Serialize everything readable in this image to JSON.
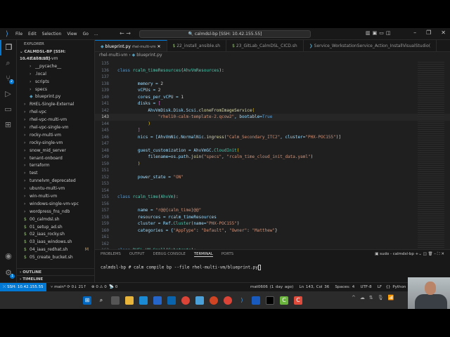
{
  "menu": [
    "File",
    "Edit",
    "Selection",
    "View",
    "Go",
    "..."
  ],
  "command_center": "calmdsl-bp [SSH: 10.42.155.55]",
  "sidebar": {
    "title": "EXPLORER",
    "root": "CALMDSL-BP [SSH: 10.42.155.55]",
    "items": [
      {
        "label": "rhel-multi-vm",
        "type": "folder-open",
        "depth": 1
      },
      {
        "label": "__pycache__",
        "type": "folder",
        "depth": 2
      },
      {
        "label": ".local",
        "type": "folder",
        "depth": 2
      },
      {
        "label": "scripts",
        "type": "folder",
        "depth": 2
      },
      {
        "label": "specs",
        "type": "folder",
        "depth": 2
      },
      {
        "label": "blueprint.py",
        "type": "py",
        "depth": 2
      },
      {
        "label": "RHEL-Single-External",
        "type": "folder",
        "depth": 1
      },
      {
        "label": "rhel-vpc",
        "type": "folder",
        "depth": 1
      },
      {
        "label": "rhel-vpc-multi-vm",
        "type": "folder",
        "depth": 1
      },
      {
        "label": "rhel-vpc-single-vm",
        "type": "folder",
        "depth": 1
      },
      {
        "label": "rocky-multi-vm",
        "type": "folder",
        "depth": 1
      },
      {
        "label": "rocky-single-vm",
        "type": "folder",
        "depth": 1
      },
      {
        "label": "snow_mid_server",
        "type": "folder",
        "depth": 1
      },
      {
        "label": "tenant-onboard",
        "type": "folder",
        "depth": 1
      },
      {
        "label": "terraform",
        "type": "folder",
        "depth": 1
      },
      {
        "label": "test",
        "type": "folder",
        "depth": 1
      },
      {
        "label": "tunnelvm_deprecated",
        "type": "folder",
        "depth": 1
      },
      {
        "label": "ubuntu-multi-vm",
        "type": "folder",
        "depth": 1
      },
      {
        "label": "win-multi-vm",
        "type": "folder",
        "depth": 1
      },
      {
        "label": "windows-single-vm-vpc",
        "type": "folder",
        "depth": 1
      },
      {
        "label": "wordpress_fns_ndb",
        "type": "folder",
        "depth": 1
      },
      {
        "label": "00_calmdsl.sh",
        "type": "sh",
        "depth": 1
      },
      {
        "label": "01_setup_ad.sh",
        "type": "sh",
        "depth": 1
      },
      {
        "label": "02_iaas_rocky.sh",
        "type": "sh",
        "depth": 1
      },
      {
        "label": "03_iaas_windows.sh",
        "type": "sh",
        "depth": 1
      },
      {
        "label": "04_iaas_redhat.sh",
        "type": "sh",
        "depth": 1,
        "badge": "M"
      },
      {
        "label": "05_create_bucket.sh",
        "type": "sh",
        "depth": 1
      }
    ],
    "outline": "OUTLINE",
    "timeline": "TIMELINE"
  },
  "activity": {
    "scm_badge": "2",
    "settings_badge": "1"
  },
  "tabs": [
    {
      "label": "blueprint.py",
      "sub": "rhel-multi-vm",
      "active": true,
      "icon": "python-icon"
    },
    {
      "label": "22_install_ansible.sh",
      "icon": "shell-icon"
    },
    {
      "label": "23_GitLab_CalmDSL_CICD.sh",
      "icon": "shell-icon"
    },
    {
      "label": "Service_WorkstationService_Action_InstallVisualStudio(",
      "icon": "powershell-icon"
    }
  ],
  "breadcrumb": [
    "rhel-multi-vm",
    "blueprint.py"
  ],
  "code": [
    {
      "n": "135",
      "t": []
    },
    {
      "n": "136",
      "t": [
        [
          "class ",
          "k"
        ],
        [
          "rcalm_timeResources",
          "c"
        ],
        [
          "(",
          "p"
        ],
        [
          "AhvVmResources",
          "c"
        ],
        [
          "):",
          "p"
        ]
      ]
    },
    {
      "n": "137",
      "t": []
    },
    {
      "n": "138",
      "t": [
        [
          "        memory = ",
          "v"
        ],
        [
          "2",
          "p"
        ]
      ]
    },
    {
      "n": "139",
      "t": [
        [
          "        vCPUs = ",
          "v"
        ],
        [
          "2",
          "p"
        ]
      ]
    },
    {
      "n": "140",
      "t": [
        [
          "        cores_per_vCPU = ",
          "v"
        ],
        [
          "1",
          "p"
        ]
      ]
    },
    {
      "n": "141",
      "t": [
        [
          "        disks = ",
          "v"
        ],
        [
          "[",
          "b"
        ]
      ]
    },
    {
      "n": "142",
      "t": [
        [
          "            AhvVmDisk.Disk.Scsi.",
          "v"
        ],
        [
          "cloneFromImageService",
          "f"
        ],
        [
          "(",
          "y"
        ]
      ]
    },
    {
      "n": "143",
      "t": [
        [
          "                ",
          "p"
        ],
        [
          "\"rhel10-calm-template-2.qcow2\"",
          "s"
        ],
        [
          ", bootable=",
          "v"
        ],
        [
          "True",
          "k"
        ]
      ]
    },
    {
      "n": "144",
      "t": [
        [
          "            )",
          "y"
        ]
      ]
    },
    {
      "n": "145",
      "t": [
        [
          "        ]",
          "b"
        ]
      ]
    },
    {
      "n": "146",
      "t": [
        [
          "        nics = [AhvVmNic.NormalNic.",
          "v"
        ],
        [
          "ingress",
          "f"
        ],
        [
          "(",
          "p"
        ],
        [
          "\"Calm_Secondary_ITC2\"",
          "s"
        ],
        [
          ", cluster=",
          "v"
        ],
        [
          "\"PHX-POC155\"",
          "s"
        ],
        [
          ")]",
          "p"
        ]
      ]
    },
    {
      "n": "147",
      "t": []
    },
    {
      "n": "148",
      "t": [
        [
          "        guest_customization = AhvVmGC.",
          "v"
        ],
        [
          "CloudInit",
          "c"
        ],
        [
          "(",
          "y"
        ]
      ]
    },
    {
      "n": "149",
      "t": [
        [
          "            filename=os.path.",
          "v"
        ],
        [
          "join",
          "f"
        ],
        [
          "(",
          "p"
        ],
        [
          "\"specs\"",
          "s"
        ],
        [
          ", ",
          "p"
        ],
        [
          "\"rcalm_time_cloud_init_data.yaml\"",
          "s"
        ],
        [
          ")",
          "p"
        ]
      ]
    },
    {
      "n": "150",
      "t": [
        [
          "        )",
          "y"
        ]
      ]
    },
    {
      "n": "151",
      "t": []
    },
    {
      "n": "152",
      "t": [
        [
          "        power_state = ",
          "v"
        ],
        [
          "\"ON\"",
          "s"
        ]
      ]
    },
    {
      "n": "153",
      "t": []
    },
    {
      "n": "154",
      "t": []
    },
    {
      "n": "155",
      "t": [
        [
          "class ",
          "k"
        ],
        [
          "rcalm_time",
          "c"
        ],
        [
          "(",
          "p"
        ],
        [
          "AhvVm",
          "c"
        ],
        [
          "):",
          "p"
        ]
      ]
    },
    {
      "n": "156",
      "t": []
    },
    {
      "n": "157",
      "t": [
        [
          "        name = ",
          "v"
        ],
        [
          "\"r@@{calm_time}@@\"",
          "s"
        ]
      ]
    },
    {
      "n": "158",
      "t": [
        [
          "        resources = rcalm_timeResources",
          "v"
        ]
      ]
    },
    {
      "n": "159",
      "t": [
        [
          "        cluster = Ref.",
          "v"
        ],
        [
          "Cluster",
          "c"
        ],
        [
          "(name=",
          "v"
        ],
        [
          "\"PHX-POC155\"",
          "s"
        ],
        [
          ")",
          "p"
        ]
      ]
    },
    {
      "n": "160",
      "t": [
        [
          "        categories = {",
          "v"
        ],
        [
          "\"AppType\"",
          "s"
        ],
        [
          ": ",
          "p"
        ],
        [
          "\"Default\"",
          "s"
        ],
        [
          ", ",
          "p"
        ],
        [
          "\"Owner\"",
          "s"
        ],
        [
          ": ",
          "p"
        ],
        [
          "\"Matthew\"",
          "s"
        ],
        [
          "}",
          "p"
        ]
      ]
    },
    {
      "n": "161",
      "t": []
    },
    {
      "n": "162",
      "t": []
    },
    {
      "n": "163",
      "t": [
        [
          "class ",
          "k"
        ],
        [
          "RHEL_VM_Small",
          "c"
        ],
        [
          "(",
          "p"
        ],
        [
          "Substrate",
          "c"
        ],
        [
          "):",
          "p"
        ]
      ]
    }
  ],
  "current_line": "143",
  "panel": {
    "tabs": [
      "PROBLEMS",
      "OUTPUT",
      "DEBUG CONSOLE",
      "TERMINAL",
      "PORTS"
    ],
    "active": "TERMINAL",
    "terminal_name": "sudo - calmdsl-bp",
    "prompt": "calmdsl-bp # calm compile bp --file rhel-multi-vm/blueprint.py"
  },
  "status": {
    "remote": "SSH: 10.42.155.55",
    "branch": "main*",
    "sync": "0↓ 21↑",
    "errors": "0",
    "warnings": "0",
    "ports": "0",
    "blame": "mat0606 (1 day ago)",
    "position": "Ln 143, Col 36",
    "spaces": "Spaces: 4",
    "encoding": "UTF-8",
    "eol": "LF",
    "language": "Python"
  },
  "colors": {
    "accent": "#0078d4",
    "background": "#1f1f1f"
  }
}
